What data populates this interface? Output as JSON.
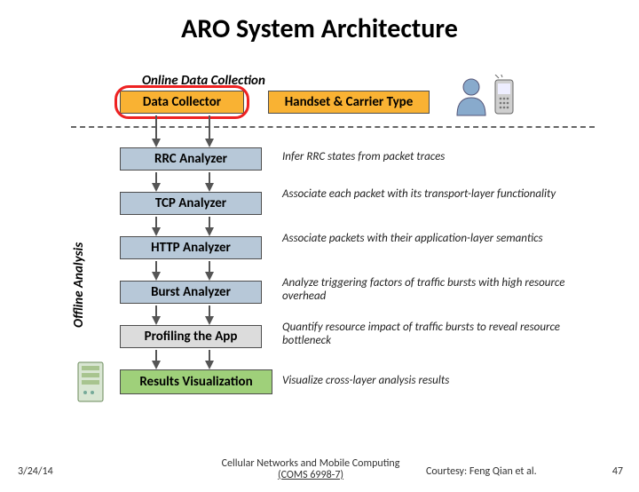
{
  "title": "ARO System Architecture",
  "sections": {
    "online_label": "Online Data Collection",
    "offline_label": "Offline Analysis"
  },
  "boxes": {
    "data_collector": "Data Collector",
    "handset_carrier": "Handset & Carrier Type",
    "rrc": "RRC Analyzer",
    "tcp": "TCP Analyzer",
    "http": "HTTP Analyzer",
    "burst": "Burst Analyzer",
    "profiling": "Profiling the App",
    "results": "Results Visualization"
  },
  "descriptions": {
    "rrc": "Infer RRC states from packet traces",
    "tcp": "Associate each packet with its transport-layer functionality",
    "http": "Associate packets with their application-layer semantics",
    "burst": "Analyze triggering factors of traffic bursts with high resource overhead",
    "profiling": "Quantify resource impact of traffic bursts to reveal resource bottleneck",
    "results": "Visualize cross-layer analysis results"
  },
  "colors": {
    "orange": "#f9b233",
    "bluegrey": "#b7c8d8",
    "green": "#9fd07a",
    "grey": "#dcdcdc"
  },
  "footer": {
    "date": "3/24/14",
    "mid_line1": "Cellular Networks and Mobile Computing",
    "mid_line2": "(COMS 6998-7)",
    "courtesy": "Courtesy: Feng Qian et al.",
    "page": "47"
  }
}
